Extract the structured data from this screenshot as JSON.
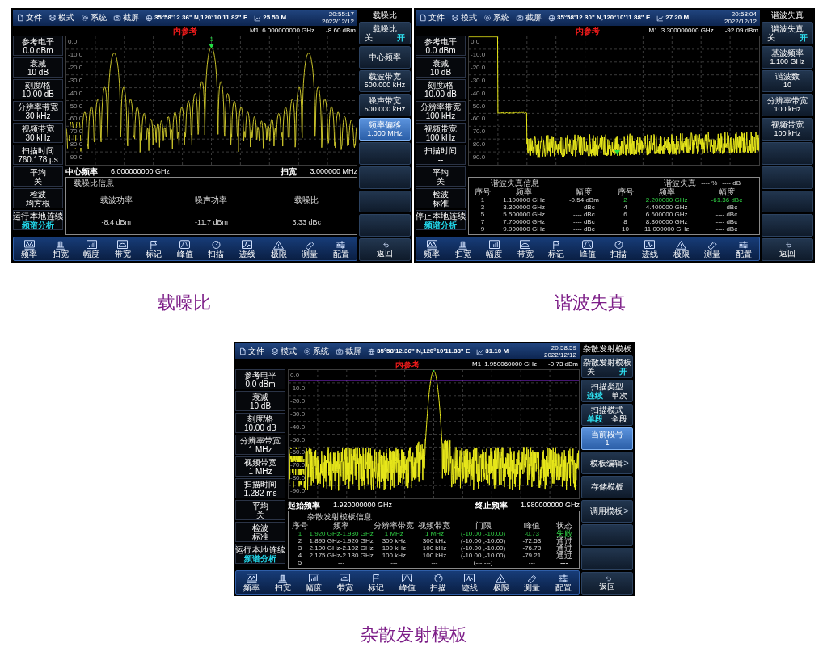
{
  "screens": [
    {
      "top_bar": {
        "menu": [
          "文件",
          "模式",
          "系统",
          "截屏"
        ],
        "location": "35°58'12.36\" N,120°10'11.82\" E",
        "altitude": "25.50 M",
        "time": "20:55:17",
        "date": "2022/12/12"
      },
      "reference": "内参考",
      "marker": {
        "label": "M1",
        "frequency": "6.000000000 GHz",
        "level": "-8.60 dBm"
      },
      "parameters": [
        {
          "label": "参考电平",
          "value": "0.0 dBm"
        },
        {
          "label": "衰减",
          "value": "10 dB"
        },
        {
          "label": "刻度/格",
          "value": "10.00 dB"
        },
        {
          "label": "分辨率带宽",
          "value": "30 kHz"
        },
        {
          "label": "视频带宽",
          "value": "30 kHz"
        },
        {
          "label": "扫描时间",
          "value": "760.178 µs"
        },
        {
          "label": "平均",
          "value": "关"
        },
        {
          "label": "检波",
          "value": "均方根"
        }
      ],
      "status": {
        "flags": [
          "运行",
          "本地",
          "连续"
        ],
        "mode": "频谱分析"
      },
      "plot": {
        "kind": "sinc_peaks",
        "marker_tag": "1",
        "y_labels": [
          "0.0",
          "-10.0",
          "-20.0",
          "-30.0",
          "-40.0",
          "-50.0",
          "-60.0",
          "-70.0",
          "-80.0",
          "-90.0"
        ]
      },
      "axis_bar": {
        "left_label": "中心频率",
        "left_value": "6.000000000 GHz",
        "right_label": "扫宽",
        "right_value": "3.000000 MHz"
      },
      "info": {
        "kind": "cnr",
        "title": "载噪比信息",
        "items": [
          {
            "label": "载波功率",
            "value": "-8.4 dBm"
          },
          {
            "label": "噪声功率",
            "value": "-11.7 dBm"
          },
          {
            "label": "载噪比",
            "value": "3.33 dBc"
          }
        ]
      },
      "toolbar": [
        "频率",
        "扫宽",
        "幅度",
        "带宽",
        "标记",
        "峰值",
        "扫描",
        "迹线",
        "极限",
        "测量",
        "配置"
      ],
      "softkey_title": "载噪比",
      "softkeys": [
        {
          "kind": "toggle",
          "label": "载噪比",
          "selected": false,
          "options": [
            {
              "label": "关",
              "selected": false
            },
            {
              "label": "开",
              "selected": true
            }
          ]
        },
        {
          "kind": "action",
          "label": "中心频率",
          "selected": false
        },
        {
          "kind": "value",
          "label": "载波带宽",
          "value": "500.000 kHz",
          "selected": false
        },
        {
          "kind": "value",
          "label": "噪声带宽",
          "value": "500.000 kHz",
          "selected": false
        },
        {
          "kind": "value",
          "label": "频率偏移",
          "value": "1.000 MHz",
          "selected": true
        },
        {
          "kind": "empty"
        },
        {
          "kind": "empty"
        },
        {
          "kind": "empty"
        },
        {
          "kind": "empty"
        }
      ],
      "back_label": "返回",
      "caption": "载噪比"
    },
    {
      "top_bar": {
        "menu": [
          "文件",
          "模式",
          "系统",
          "截屏"
        ],
        "location": "35°58'12.30\" N,120°10'11.88\" E",
        "altitude": "27.20 M",
        "time": "20:58:04",
        "date": "2022/12/12"
      },
      "reference": "内参考",
      "marker": {
        "label": "M1",
        "frequency": "3.300000000 GHz",
        "level": "-92.09 dBm"
      },
      "parameters": [
        {
          "label": "参考电平",
          "value": "0.0 dBm"
        },
        {
          "label": "衰减",
          "value": "10 dB"
        },
        {
          "label": "刻度/格",
          "value": "10.00 dB"
        },
        {
          "label": "分辨率带宽",
          "value": "100 kHz"
        },
        {
          "label": "视频带宽",
          "value": "100 kHz"
        },
        {
          "label": "扫描时间",
          "value": "--"
        },
        {
          "label": "平均",
          "value": "关"
        },
        {
          "label": "检波",
          "value": "标准"
        }
      ],
      "status": {
        "flags": [
          "停止",
          "本地",
          "连续"
        ],
        "mode": "频谱分析"
      },
      "plot": {
        "kind": "harmonics",
        "y_labels": [
          "0.0",
          "-10.0",
          "-20.0",
          "-30.0",
          "-40.0",
          "-50.0",
          "-60.0",
          "-70.0",
          "-80.0",
          "-90.0"
        ]
      },
      "info": {
        "kind": "harmonic",
        "title": "谐波失真信息",
        "summary": {
          "label": "谐波失真",
          "percent": "---- %",
          "db": "---- dB"
        },
        "headers": [
          "序号",
          "频率",
          "幅度",
          "序号",
          "频率",
          "幅度"
        ],
        "entries": [
          {
            "index": "1",
            "frequency": "1.100000 GHz",
            "amplitude": "-0.54 dBm",
            "highlighted": false
          },
          {
            "index": "2",
            "frequency": "2.200000 GHz",
            "amplitude": "-61.36 dBc",
            "highlighted": true
          },
          {
            "index": "3",
            "frequency": "3.300000 GHz",
            "amplitude": "---- dBc",
            "highlighted": false
          },
          {
            "index": "4",
            "frequency": "4.400000 GHz",
            "amplitude": "---- dBc",
            "highlighted": false
          },
          {
            "index": "5",
            "frequency": "5.500000 GHz",
            "amplitude": "---- dBc",
            "highlighted": false
          },
          {
            "index": "6",
            "frequency": "6.600000 GHz",
            "amplitude": "---- dBc",
            "highlighted": false
          },
          {
            "index": "7",
            "frequency": "7.700000 GHz",
            "amplitude": "---- dBc",
            "highlighted": false
          },
          {
            "index": "8",
            "frequency": "8.800000 GHz",
            "amplitude": "---- dBc",
            "highlighted": false
          },
          {
            "index": "9",
            "frequency": "9.900000 GHz",
            "amplitude": "---- dBc",
            "highlighted": false
          },
          {
            "index": "10",
            "frequency": "11.000000 GHz",
            "amplitude": "---- dBc",
            "highlighted": false
          }
        ]
      },
      "toolbar": [
        "频率",
        "扫宽",
        "幅度",
        "带宽",
        "标记",
        "峰值",
        "扫描",
        "迹线",
        "极限",
        "测量",
        "配置"
      ],
      "softkey_title": "谐波失真",
      "softkeys": [
        {
          "kind": "toggle",
          "label": "谐波失真",
          "selected": false,
          "options": [
            {
              "label": "关",
              "selected": false
            },
            {
              "label": "开",
              "selected": true
            }
          ]
        },
        {
          "kind": "value",
          "label": "基波频率",
          "value": "1.100 GHz",
          "selected": false
        },
        {
          "kind": "value",
          "label": "谐波数",
          "value": "10",
          "selected": false
        },
        {
          "kind": "value",
          "label": "分辨率带宽",
          "value": "100 kHz",
          "selected": false
        },
        {
          "kind": "value",
          "label": "视频带宽",
          "value": "100 kHz",
          "selected": false
        },
        {
          "kind": "empty"
        },
        {
          "kind": "empty"
        },
        {
          "kind": "empty"
        },
        {
          "kind": "empty"
        }
      ],
      "back_label": "返回",
      "caption": "谐波失真"
    },
    {
      "top_bar": {
        "menu": [
          "文件",
          "模式",
          "系统",
          "截屏"
        ],
        "location": "35°58'12.36\" N,120°10'11.88\" E",
        "altitude": "31.10 M",
        "time": "20:58:59",
        "date": "2022/12/12"
      },
      "reference": "内参考",
      "marker": {
        "label": "M1",
        "frequency": "1.950060000 GHz",
        "level": "-0.73 dBm"
      },
      "parameters": [
        {
          "label": "参考电平",
          "value": "0.0 dBm"
        },
        {
          "label": "衰减",
          "value": "10 dB"
        },
        {
          "label": "刻度/格",
          "value": "10.00 dB"
        },
        {
          "label": "分辨率带宽",
          "value": "1 MHz"
        },
        {
          "label": "视频带宽",
          "value": "1 MHz"
        },
        {
          "label": "扫描时间",
          "value": "1.282 ms"
        },
        {
          "label": "平均",
          "value": "关"
        },
        {
          "label": "检波",
          "value": "标准"
        }
      ],
      "status": {
        "flags": [
          "运行",
          "本地",
          "连续"
        ],
        "mode": "频谱分析"
      },
      "plot": {
        "kind": "spur_mask",
        "y_labels": [
          "0.0",
          "-10.0",
          "-20.0",
          "-30.0",
          "-40.0",
          "-50.0",
          "-60.0",
          "-70.0",
          "-80.0",
          "-90.0"
        ]
      },
      "axis_bar": {
        "left_label": "起始频率",
        "left_value": "1.920000000 GHz",
        "right_label": "终止频率",
        "right_value": "1.980000000 GHz"
      },
      "info": {
        "kind": "spurious",
        "title": "杂散发射模板信息",
        "headers": [
          "序号",
          "频率",
          "分辨率带宽",
          "视频带宽",
          "门限",
          "峰值",
          "状态"
        ],
        "rows": [
          {
            "cells": [
              "1",
              "1.920 GHz-1.980 GHz",
              "1 MHz",
              "1 MHz",
              "(-10.00 ,-10.00)",
              "-0.73",
              "失败"
            ],
            "highlighted": true
          },
          {
            "cells": [
              "2",
              "1.895 GHz-1.920 GHz",
              "300 kHz",
              "300 kHz",
              "(-10.00 ,-10.00)",
              "-72.53",
              "通过"
            ],
            "highlighted": false
          },
          {
            "cells": [
              "3",
              "2.100 GHz-2.102 GHz",
              "100 kHz",
              "100 kHz",
              "(-10.00 ,-10.00)",
              "-76.78",
              "通过"
            ],
            "highlighted": false
          },
          {
            "cells": [
              "4",
              "2.175 GHz-2.180 GHz",
              "100 kHz",
              "100 kHz",
              "(-10.00 ,-10.00)",
              "-79.21",
              "通过"
            ],
            "highlighted": false
          },
          {
            "cells": [
              "5",
              "---",
              "---",
              "---",
              "(---,---)",
              "---",
              "---"
            ],
            "highlighted": false
          }
        ]
      },
      "toolbar": [
        "频率",
        "扫宽",
        "幅度",
        "带宽",
        "标记",
        "峰值",
        "扫描",
        "迹线",
        "极限",
        "测量",
        "配置"
      ],
      "softkey_title": "杂散发射模板",
      "softkeys": [
        {
          "kind": "toggle",
          "label": "杂散发射模板",
          "selected": false,
          "options": [
            {
              "label": "关",
              "selected": false
            },
            {
              "label": "开",
              "selected": true
            }
          ]
        },
        {
          "kind": "toggle",
          "label": "扫描类型",
          "selected": false,
          "options": [
            {
              "label": "连续",
              "selected": true
            },
            {
              "label": "单次",
              "selected": false
            }
          ]
        },
        {
          "kind": "toggle",
          "label": "扫描模式",
          "selected": false,
          "options": [
            {
              "label": "单段",
              "selected": true
            },
            {
              "label": "全段",
              "selected": false
            }
          ]
        },
        {
          "kind": "value",
          "label": "当前段号",
          "value": "1",
          "selected": true
        },
        {
          "kind": "submenu",
          "label": "模板编辑",
          "arrow": ">",
          "selected": false
        },
        {
          "kind": "action",
          "label": "存储模板",
          "selected": false
        },
        {
          "kind": "submenu",
          "label": "调用模板",
          "arrow": ">",
          "selected": false
        },
        {
          "kind": "empty"
        },
        {
          "kind": "empty"
        }
      ],
      "back_label": "返回",
      "caption": "杂散发射模板"
    }
  ]
}
